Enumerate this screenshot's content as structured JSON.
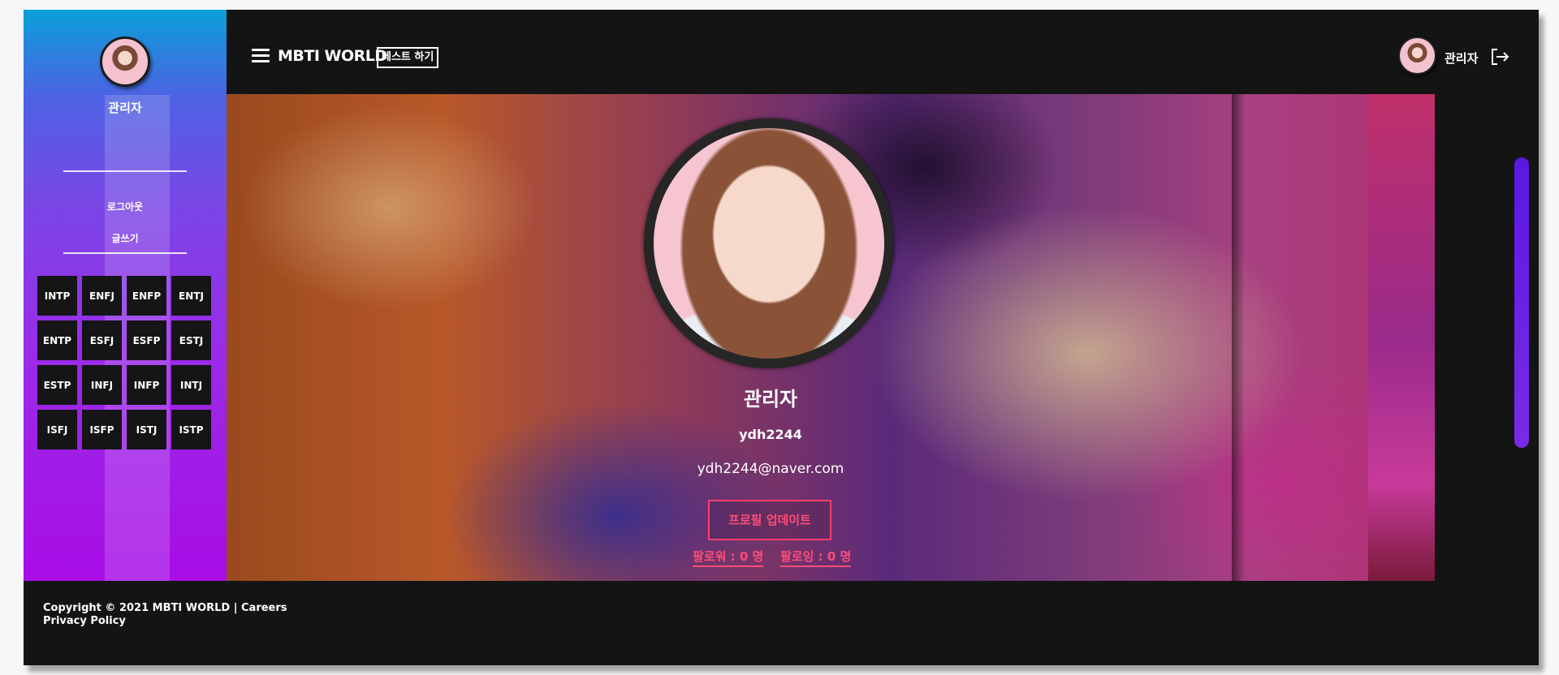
{
  "sidebar": {
    "user_name": "관리자",
    "links": [
      "로그아웃",
      "글쓰기"
    ],
    "mbti_types": [
      "INTP",
      "ENFJ",
      "ENFP",
      "ENTJ",
      "ENTP",
      "ESFJ",
      "ESFP",
      "ESTJ",
      "ESTP",
      "INFJ",
      "INFP",
      "INTJ",
      "ISFJ",
      "ISFP",
      "ISTJ",
      "ISTP"
    ]
  },
  "header": {
    "brand": "MBTI WORLD",
    "test_button": "테스트 하기",
    "user_name": "관리자",
    "icons": [
      "hamburger-icon",
      "logout-icon"
    ]
  },
  "profile": {
    "name": "관리자",
    "user_id": "ydh2244",
    "email": "ydh2244@naver.com",
    "update_button": "프로필 업데이트",
    "followers": "팔로워 : 0 명",
    "following": "팔로잉 : 0 명"
  },
  "footer": {
    "copyright": "Copyright © 2021 MBTI WORLD | Careers",
    "privacy": "Privacy Policy"
  },
  "colors": {
    "accent": "#ff4d78",
    "sidebar_top": "#0aa0d8",
    "sidebar_bottom": "#a80de6",
    "background": "#141414"
  }
}
